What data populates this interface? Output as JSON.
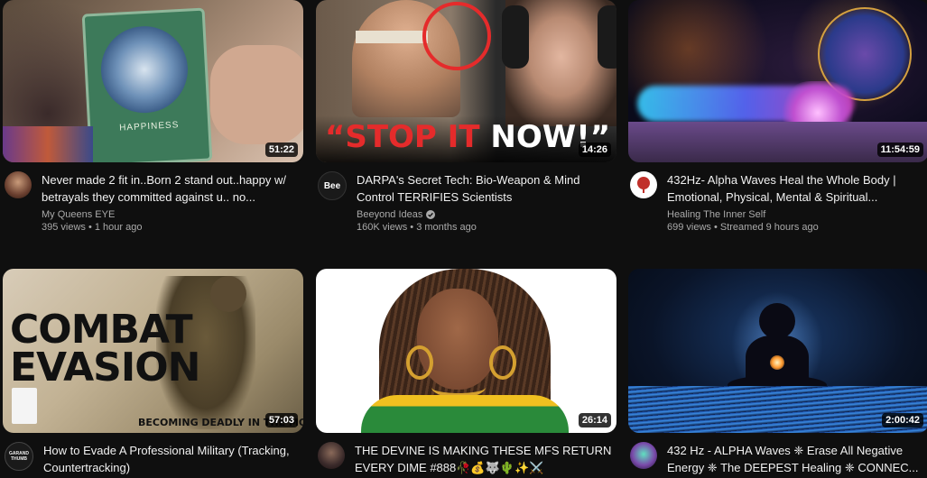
{
  "videos": [
    {
      "title": "Never made 2 fit in..Born 2 stand out..happy w/ betrayals they committed against u.. no...",
      "channel": "My Queens EYE",
      "stats": "395 views • 1 hour ago",
      "duration": "51:22",
      "thumb_text": "HAPPINESS"
    },
    {
      "title": "DARPA's Secret Tech: Bio-Weapon & Mind Control TERRIFIES Scientists",
      "channel": "Beeyond Ideas",
      "stats": "160K views • 3 months ago",
      "duration": "14:26",
      "thumb_text_red": "“STOP IT",
      "thumb_text_white": "NOW!”",
      "avatar_text": "Bee"
    },
    {
      "title": "432Hz- Alpha Waves Heal the Whole Body | Emotional, Physical, Mental & Spiritual...",
      "channel": "Healing The Inner Self",
      "stats": "699 views • Streamed 9 hours ago",
      "duration": "11:54:59"
    },
    {
      "title": "How to Evade A Professional Military (Tracking, Countertracking)",
      "channel": "",
      "stats": "",
      "duration": "57:03",
      "thumb_text_1": "COMBAT",
      "thumb_text_2": "EVASION",
      "thumb_text_3": "BECOMING DEADLY IN THE MOUN",
      "avatar_text": "GARAND THUMB"
    },
    {
      "title": "THE DEVINE IS MAKING THESE MFS RETURN EVERY DIME #888🥀💰🐺🌵✨⚔️",
      "channel": "",
      "stats": "",
      "duration": "26:14"
    },
    {
      "title": "432 Hz - ALPHA Waves ❈ Erase All Negative Energy ❈ The DEEPEST Healing ❈ CONNEC...",
      "channel": "",
      "stats": "",
      "duration": "2:00:42"
    }
  ],
  "colors": {
    "background": "#0f0f0f",
    "title": "#f1f1f1",
    "secondary": "#aaaaaa",
    "accent_red": "#e52b2b"
  }
}
